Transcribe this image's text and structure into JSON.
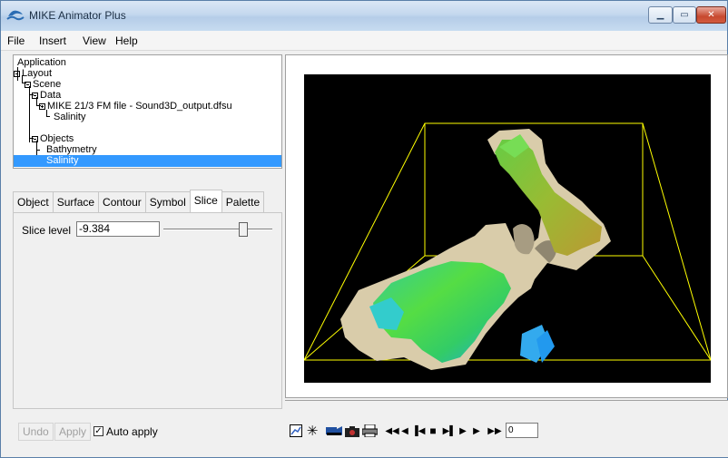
{
  "window": {
    "title": "MIKE Animator Plus"
  },
  "menu": [
    "File",
    "Insert",
    "View",
    "Help"
  ],
  "tree": {
    "root": "Application",
    "layout": "Layout",
    "scene": "Scene",
    "data": "Data",
    "file": "MIKE 21/3 FM file - Sound3D_output.dfsu",
    "file_child": "Salinity",
    "objects": "Objects",
    "obj_bathymetry": "Bathymetry",
    "obj_salinity": "Salinity"
  },
  "tabs": [
    "Object",
    "Surface",
    "Contour",
    "Symbol",
    "Slice",
    "Palette"
  ],
  "active_tab": "Slice",
  "slice": {
    "label": "Slice level",
    "value": "-9.384",
    "slider_fraction": 0.75
  },
  "bottom": {
    "undo": "Undo",
    "apply": "Apply",
    "auto_apply": "Auto apply",
    "auto_apply_checked": true
  },
  "toolbar": {
    "frame_value": "0",
    "icons": [
      "edit-chart-icon",
      "asterisk-icon",
      "record-icon",
      "camera-icon",
      "print-icon",
      "rewind-icon",
      "step-back-icon",
      "first-frame-icon",
      "stop-icon",
      "last-frame-icon",
      "step-forward-icon",
      "fast-forward-icon"
    ]
  },
  "colors": {
    "selection": "#3399ff",
    "scene_bg": "#000000",
    "bounding_box": "#ffff00"
  }
}
